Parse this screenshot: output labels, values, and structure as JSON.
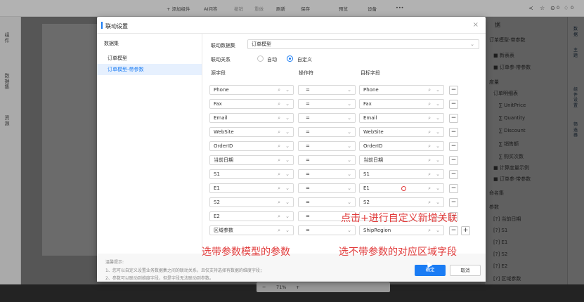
{
  "toolbar": {
    "add_component": "+ 添加组件",
    "ai": "AI问答",
    "undo": "撤销",
    "redo": "重做",
    "refresh": "刷新",
    "save": "保存",
    "preview": "预览",
    "device": "设备",
    "more": "•••",
    "counter_1": "0",
    "counter_2": "0"
  },
  "left_rail": [
    "组件",
    "数据集",
    "资源"
  ],
  "right_panel": {
    "title": "据",
    "model_1": "订单模型-带参数",
    "tree": [
      "■ 新表表",
      "■ 订单参·带参数",
      "度量",
      "订单明细表",
      "∑ UnitPrice",
      "∑ Quantity",
      "∑ Discount",
      "∑ 销售额",
      "∑ 购买次数",
      "■ 计算度量示例",
      "■ 订单参·带参数",
      "命名集",
      "参数",
      "[?] 当前日期",
      "[?] S1",
      "[?] E1",
      "[?] S2",
      "[?] E2",
      "[?] 区域参数"
    ]
  },
  "right_rail": [
    "数据",
    "主题",
    "组件设置",
    "筛选器"
  ],
  "zoom": {
    "value": "71%"
  },
  "dialog": {
    "title": "联动设置",
    "close": "×",
    "dataset_header": "数据集",
    "datasets": [
      "订单模型",
      "订单模型-带参数"
    ],
    "linked_dataset_label": "联动数据集",
    "linked_dataset_value": "订单模型",
    "relation_label": "联动关系",
    "relation_auto": "自动",
    "relation_custom": "自定义",
    "col_source": "源字段",
    "col_operator": "操作符",
    "col_target": "目标字段",
    "rows": [
      {
        "source": "Phone",
        "op": "=",
        "target": "Phone"
      },
      {
        "source": "Fax",
        "op": "=",
        "target": "Fax"
      },
      {
        "source": "Email",
        "op": "=",
        "target": "Email"
      },
      {
        "source": "WebSite",
        "op": "=",
        "target": "WebSite"
      },
      {
        "source": "OrderID",
        "op": "=",
        "target": "OrderID"
      },
      {
        "source": "当前日期",
        "op": "=",
        "target": "当前日期"
      },
      {
        "source": "S1",
        "op": "=",
        "target": "S1"
      },
      {
        "source": "E1",
        "op": "=",
        "target": "E1"
      },
      {
        "source": "S2",
        "op": "=",
        "target": "S2"
      },
      {
        "source": "E2",
        "op": "=",
        "target": ""
      },
      {
        "source": "区域参数",
        "op": "=",
        "target": "ShipRegion"
      }
    ],
    "tips_title": "温馨提示:",
    "tip_1": "1、您可以自定义设置业务数据集之间的联动关系，且仅支持选择有数据的维度字段；",
    "tip_2": "2、参数可以联动到维度字段，但是字段无法联动到参数。",
    "ok": "确定",
    "cancel": "取消"
  },
  "annotations": {
    "add_tip": "点击+进行自定义新增关联",
    "source_tip": "选带参数模型的参数",
    "target_tip": "选不带参数的对应区域字段"
  },
  "colors": {
    "accent": "#1a7cf4",
    "annotation": "#e13b3b"
  }
}
